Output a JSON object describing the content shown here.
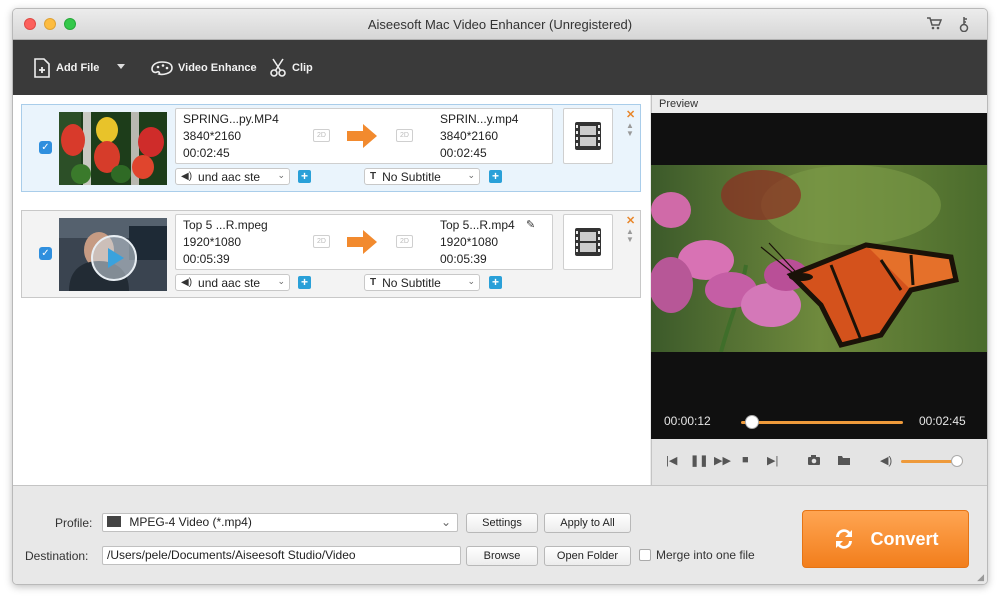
{
  "window": {
    "title": "Aiseesoft Mac Video Enhancer (Unregistered)"
  },
  "toolbar": {
    "add_file": "Add File",
    "video_enhance": "Video Enhance",
    "clip": "Clip"
  },
  "files": [
    {
      "src_name": "SPRING...py.MP4",
      "src_res": "3840*2160",
      "src_dur": "00:02:45",
      "dst_name": "SPRIN...y.mp4",
      "dst_res": "3840*2160",
      "dst_dur": "00:02:45",
      "audio": "und aac ste",
      "subtitle": "No Subtitle",
      "badge": "2D"
    },
    {
      "src_name": "Top 5 ...R.mpeg",
      "src_res": "1920*1080",
      "src_dur": "00:05:39",
      "dst_name": "Top 5...R.mp4",
      "dst_res": "1920*1080",
      "dst_dur": "00:05:39",
      "audio": "und aac ste",
      "subtitle": "No Subtitle",
      "badge": "2D"
    }
  ],
  "preview": {
    "label": "Preview",
    "current_time": "00:00:12",
    "total_time": "00:02:45",
    "progress": 0.07,
    "volume": 0.9
  },
  "bottom": {
    "profile_label": "Profile:",
    "profile_value": "MPEG-4 Video (*.mp4)",
    "settings": "Settings",
    "apply_all": "Apply to All",
    "destination_label": "Destination:",
    "destination_value": "/Users/pele/Documents/Aiseesoft Studio/Video",
    "browse": "Browse",
    "open_folder": "Open Folder",
    "merge": "Merge into one file",
    "convert": "Convert"
  },
  "colors": {
    "accent": "#f28a2e",
    "check": "#2f8fde",
    "toolbar": "#3a3a3a"
  }
}
